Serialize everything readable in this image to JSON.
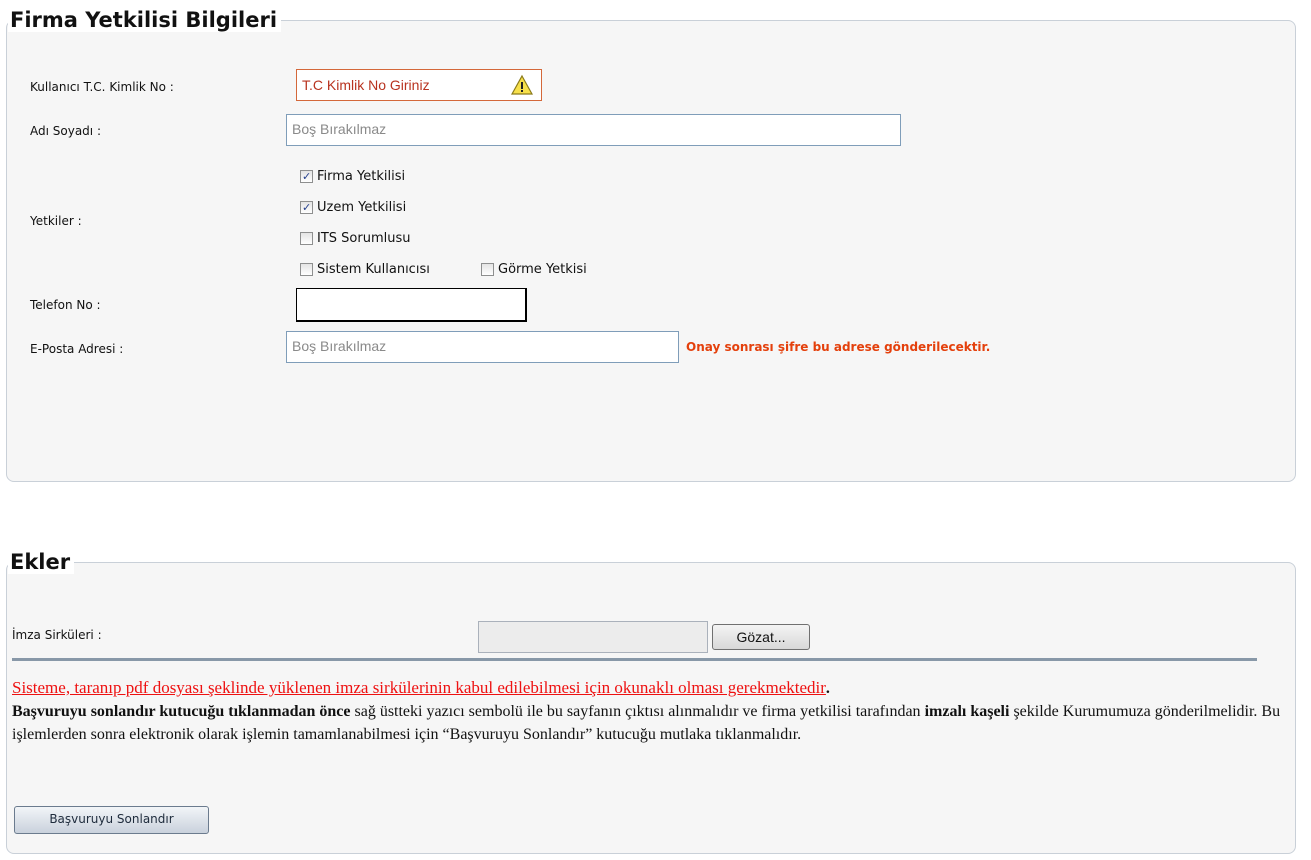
{
  "firma_section": {
    "title": "Firma Yetkilisi Bilgileri",
    "tc_label": "Kullanıcı T.C. Kimlik No :",
    "tc_value": "T.C Kimlik No Giriniz",
    "name_label": "Adı Soyadı :",
    "name_placeholder": "Boş Bırakılmaz",
    "yetkiler_label": "Yetkiler :",
    "yetkiler": [
      {
        "label": "Firma Yetkilisi",
        "checked": true
      },
      {
        "label": "Uzem Yetkilisi",
        "checked": true
      },
      {
        "label": "ITS Sorumlusu",
        "checked": false
      },
      {
        "label": "Sistem Kullanıcısı",
        "checked": false
      },
      {
        "label": "Görme Yetkisi",
        "checked": false
      }
    ],
    "phone_label": "Telefon No :",
    "phone_value": "",
    "email_label": "E-Posta Adresi :",
    "email_placeholder": "Boş Bırakılmaz",
    "email_note": "Onay sonrası şifre bu adrese gönderilecektir."
  },
  "ekler_section": {
    "title": "Ekler",
    "imza_label": "İmza Sirküleri :",
    "browse_button": "Gözat..."
  },
  "notice": {
    "red_line": "Sisteme, taranıp pdf dosyası şeklinde yüklenen imza sirkülerinin kabul edilebilmesi için okunaklı olması gerekmektedir",
    "red_line_end": ".",
    "bold1": "Başvuruyu sonlandır kutucuğu tıklanmadan önce",
    "text1": " sağ üstteki yazıcı sembolü ile bu sayfanın çıktısı alınmalıdır ve firma yetkilisi tarafından ",
    "bold2": "imzalı kaşeli",
    "text2": " şekilde Kurumumuza gönderilmelidir. Bu işlemlerden sonra elektronik olarak işlemin tamamlanabilmesi için “Başvuruyu Sonlandır” kutucuğu mutlaka tıklanmalıdır."
  },
  "finish_button": "Başvuruyu Sonlandır",
  "colors": {
    "accent_red": "#ee1111",
    "note_orange": "#e4400c",
    "warn_border": "#d4683a"
  }
}
